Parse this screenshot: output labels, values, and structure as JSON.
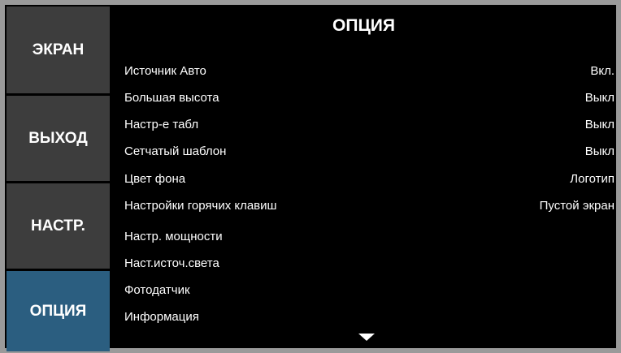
{
  "sidebar": {
    "tabs": [
      {
        "label": "ЭКРАН",
        "active": false
      },
      {
        "label": "ВЫХОД",
        "active": false
      },
      {
        "label": "НАСТР.",
        "active": false
      },
      {
        "label": "ОПЦИЯ",
        "active": true
      }
    ]
  },
  "main": {
    "title": "ОПЦИЯ",
    "items": [
      {
        "label": "Источник Авто",
        "value": "Вкл."
      },
      {
        "label": "Большая высота",
        "value": "Выкл"
      },
      {
        "label": "Настр-е табл",
        "value": "Выкл"
      },
      {
        "label": "Сетчатый шаблон",
        "value": "Выкл"
      },
      {
        "label": "Цвет фона",
        "value": "Логотип"
      },
      {
        "label": "Настройки горячих клавиш",
        "value": "Пустой экран"
      },
      {
        "label": "Настр. мощности",
        "value": ""
      },
      {
        "label": "Наст.источ.света",
        "value": ""
      },
      {
        "label": "Фотодатчик",
        "value": ""
      },
      {
        "label": "Информация",
        "value": ""
      }
    ],
    "scroll_icon": "triangle-down"
  },
  "colors": {
    "tab_bg": "#3d3d3d",
    "tab_active_bg": "#2b5e80",
    "panel_bg": "#000000",
    "text": "#ffffff",
    "frame": "#9a9a9a"
  }
}
